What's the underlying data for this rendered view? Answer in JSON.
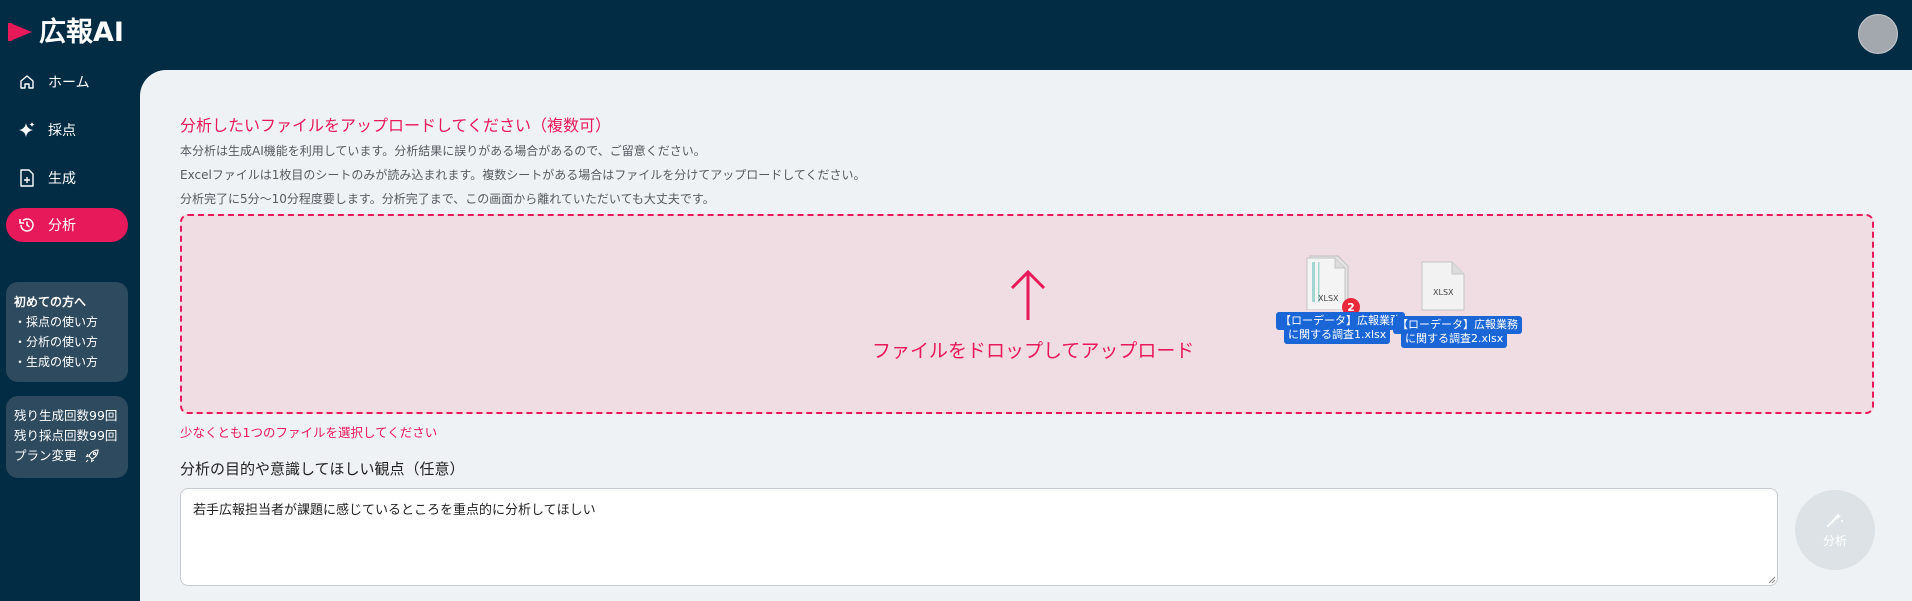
{
  "brand": {
    "name": "広報AI",
    "accent_color": "#e8195a",
    "header_bg": "#022b44"
  },
  "sidebar": {
    "items": [
      {
        "label": "ホーム",
        "icon": "home-icon",
        "active": false
      },
      {
        "label": "採点",
        "icon": "sparkle-icon",
        "active": false
      },
      {
        "label": "生成",
        "icon": "document-plus-icon",
        "active": false
      },
      {
        "label": "分析",
        "icon": "history-icon",
        "active": true
      }
    ],
    "help": {
      "title": "初めての方へ",
      "links": [
        "・採点の使い方",
        "・分析の使い方",
        "・生成の使い方"
      ]
    },
    "plan": {
      "remaining_generate": "残り生成回数99回",
      "remaining_score": "残り採点回数99回",
      "change_label": "プラン変更",
      "change_icon": "rocket-icon"
    }
  },
  "main": {
    "title": "分析したいファイルをアップロードしてください（複数可）",
    "notes": [
      "本分析は生成AI機能を利用しています。分析結果に誤りがある場合があるので、ご留意ください。",
      "Excelファイルは1枚目のシートのみが読み込まれます。複数シートがある場合はファイルを分けてアップロードしてください。",
      "分析完了に5分〜10分程度要します。分析完了まで、この画面から離れていただいても大丈夫です。"
    ],
    "dropzone": {
      "text": "ファイルをドロップしてアップロード",
      "icon": "arrow-up-icon",
      "dragged_files": [
        {
          "name_line1": "【ローデータ】広報業務",
          "name_line2": "に関する調査1.xlsx",
          "ext": "XLSX",
          "badge": "2"
        },
        {
          "name_line1": "【ローデータ】広報業務",
          "name_line2": "に関する調査2.xlsx",
          "ext": "XLSX"
        }
      ]
    },
    "error": "少なくとも1つのファイルを選択してください",
    "purpose": {
      "label": "分析の目的や意識してほしい観点（任意）",
      "value": "若手広報担当者が課題に感じているところを重点的に分析してほしい"
    },
    "analyze_button": {
      "label": "分析",
      "icon": "magic-wand-icon"
    }
  }
}
